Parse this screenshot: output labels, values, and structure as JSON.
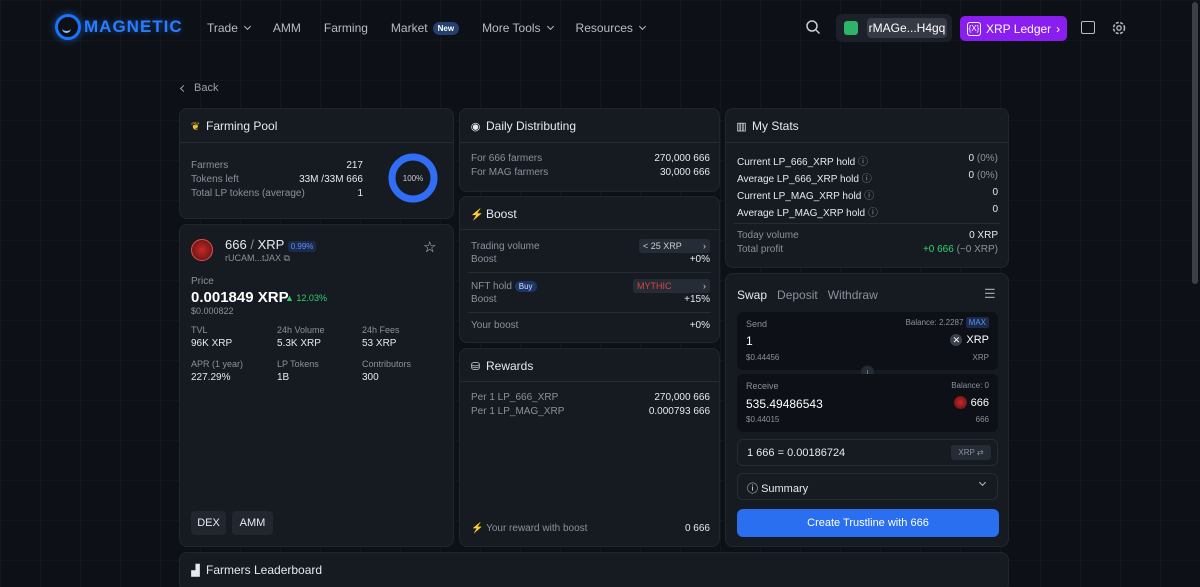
{
  "nav": {
    "logo": "MAGNETIC",
    "items": [
      {
        "label": "Trade",
        "caret": true
      },
      {
        "label": "AMM",
        "caret": false
      },
      {
        "label": "Farming",
        "caret": false
      },
      {
        "label": "Market",
        "caret": false,
        "badge": "New"
      },
      {
        "label": "More Tools",
        "caret": true
      },
      {
        "label": "Resources",
        "caret": true
      }
    ],
    "wallet": "rMAGe...H4gq",
    "network": "XRP Ledger",
    "network_icon": "{X}",
    "accent": "#8a1df0"
  },
  "back": "Back",
  "farming_pool": {
    "title": "Farming Pool",
    "rows": [
      {
        "label": "Farmers",
        "value": "217"
      },
      {
        "label": "Tokens left",
        "value": "33M /33M 666"
      },
      {
        "label": "Total LP tokens (average)",
        "value": "1"
      }
    ],
    "donut_label": "100%",
    "donut_fraction": 1
  },
  "token": {
    "pair_base": "666",
    "pair_sep": "/",
    "pair_quote": "XRP",
    "fee_badge": "0.99%",
    "issuer": "rUCAM...tJAX",
    "price_label": "Price",
    "price": "0.001849 XRP",
    "change": "12.03%",
    "price_usd": "$0.000822",
    "stats": [
      {
        "label": "TVL",
        "value": "96K XRP"
      },
      {
        "label": "24h Volume",
        "value": "5.3K XRP"
      },
      {
        "label": "24h Fees",
        "value": "53 XRP"
      },
      {
        "label": "APR (1 year)",
        "value": "227.29%"
      },
      {
        "label": "LP Tokens",
        "value": "1B"
      },
      {
        "label": "Contributors",
        "value": "300"
      }
    ],
    "buttons": [
      "DEX",
      "AMM"
    ]
  },
  "daily": {
    "title": "Daily Distributing",
    "rows": [
      {
        "label": "For 666 farmers",
        "value": "270,000 666"
      },
      {
        "label": "For MAG farmers",
        "value": "30,000 666"
      }
    ]
  },
  "boost": {
    "title": "Boost",
    "trading_label": "Trading volume",
    "trading_select": "< 25 XRP",
    "boost_label": "Boost",
    "trading_boost": "+0%",
    "nft_label": "NFT hold",
    "buy_label": "Buy",
    "nft_select": "MYTHIC",
    "nft_boost": "+15%",
    "your_boost_label": "Your boost",
    "your_boost": "+0%"
  },
  "rewards": {
    "title": "Rewards",
    "rows": [
      {
        "label": "Per 1 LP_666_XRP",
        "value": "270,000 666"
      },
      {
        "label": "Per 1 LP_MAG_XRP",
        "value": "0.000793 666"
      }
    ],
    "footer_label": "Your reward with boost",
    "footer_value": "0 666"
  },
  "my_stats": {
    "title": "My Stats",
    "rows": [
      {
        "label": "Current LP_666_XRP hold",
        "value": "0",
        "pct": "(0%)"
      },
      {
        "label": "Average LP_666_XRP hold",
        "value": "0",
        "pct": "(0%)"
      },
      {
        "label": "Current LP_MAG_XRP hold",
        "value": "0",
        "pct": ""
      },
      {
        "label": "Average LP_MAG_XRP hold",
        "value": "0",
        "pct": ""
      }
    ],
    "today_label": "Today volume",
    "today_value": "0 XRP",
    "profit_label": "Total profit",
    "profit_value": "+0 666",
    "profit_sub": "(~0 XRP)"
  },
  "swap": {
    "tabs": [
      "Swap",
      "Deposit",
      "Withdraw"
    ],
    "send_label": "Send",
    "send_balance": "Balance: 2.2287",
    "max": "MAX",
    "send_amount": "1",
    "send_token": "XRP",
    "send_usd": "$0.44456",
    "send_sub": "XRP",
    "receive_label": "Receive",
    "receive_balance": "Balance: 0",
    "receive_amount": "535.49486543",
    "receive_token": "666",
    "receive_usd": "$0.44015",
    "receive_sub": "666",
    "rate": "1 666 = 0.00186724",
    "rate_toggle": "XRP",
    "summary": "Summary",
    "cta": "Create Trustline with 666"
  },
  "leaderboard": {
    "title": "Farmers Leaderboard"
  }
}
